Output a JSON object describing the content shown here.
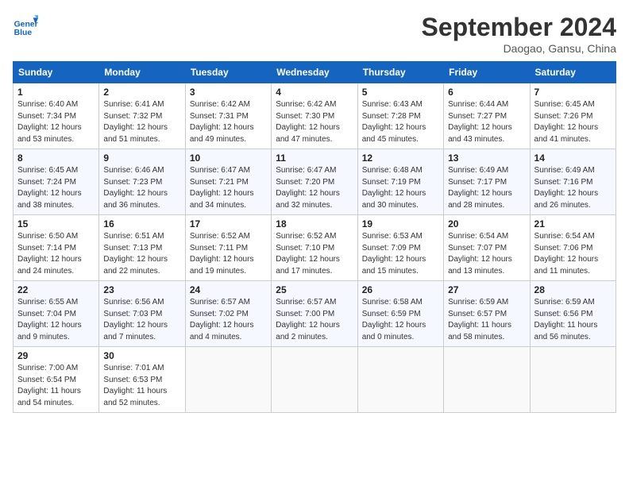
{
  "header": {
    "logo_line1": "General",
    "logo_line2": "Blue",
    "month": "September 2024",
    "location": "Daogao, Gansu, China"
  },
  "weekdays": [
    "Sunday",
    "Monday",
    "Tuesday",
    "Wednesday",
    "Thursday",
    "Friday",
    "Saturday"
  ],
  "weeks": [
    [
      {
        "day": "1",
        "info": "Sunrise: 6:40 AM\nSunset: 7:34 PM\nDaylight: 12 hours\nand 53 minutes."
      },
      {
        "day": "2",
        "info": "Sunrise: 6:41 AM\nSunset: 7:32 PM\nDaylight: 12 hours\nand 51 minutes."
      },
      {
        "day": "3",
        "info": "Sunrise: 6:42 AM\nSunset: 7:31 PM\nDaylight: 12 hours\nand 49 minutes."
      },
      {
        "day": "4",
        "info": "Sunrise: 6:42 AM\nSunset: 7:30 PM\nDaylight: 12 hours\nand 47 minutes."
      },
      {
        "day": "5",
        "info": "Sunrise: 6:43 AM\nSunset: 7:28 PM\nDaylight: 12 hours\nand 45 minutes."
      },
      {
        "day": "6",
        "info": "Sunrise: 6:44 AM\nSunset: 7:27 PM\nDaylight: 12 hours\nand 43 minutes."
      },
      {
        "day": "7",
        "info": "Sunrise: 6:45 AM\nSunset: 7:26 PM\nDaylight: 12 hours\nand 41 minutes."
      }
    ],
    [
      {
        "day": "8",
        "info": "Sunrise: 6:45 AM\nSunset: 7:24 PM\nDaylight: 12 hours\nand 38 minutes."
      },
      {
        "day": "9",
        "info": "Sunrise: 6:46 AM\nSunset: 7:23 PM\nDaylight: 12 hours\nand 36 minutes."
      },
      {
        "day": "10",
        "info": "Sunrise: 6:47 AM\nSunset: 7:21 PM\nDaylight: 12 hours\nand 34 minutes."
      },
      {
        "day": "11",
        "info": "Sunrise: 6:47 AM\nSunset: 7:20 PM\nDaylight: 12 hours\nand 32 minutes."
      },
      {
        "day": "12",
        "info": "Sunrise: 6:48 AM\nSunset: 7:19 PM\nDaylight: 12 hours\nand 30 minutes."
      },
      {
        "day": "13",
        "info": "Sunrise: 6:49 AM\nSunset: 7:17 PM\nDaylight: 12 hours\nand 28 minutes."
      },
      {
        "day": "14",
        "info": "Sunrise: 6:49 AM\nSunset: 7:16 PM\nDaylight: 12 hours\nand 26 minutes."
      }
    ],
    [
      {
        "day": "15",
        "info": "Sunrise: 6:50 AM\nSunset: 7:14 PM\nDaylight: 12 hours\nand 24 minutes."
      },
      {
        "day": "16",
        "info": "Sunrise: 6:51 AM\nSunset: 7:13 PM\nDaylight: 12 hours\nand 22 minutes."
      },
      {
        "day": "17",
        "info": "Sunrise: 6:52 AM\nSunset: 7:11 PM\nDaylight: 12 hours\nand 19 minutes."
      },
      {
        "day": "18",
        "info": "Sunrise: 6:52 AM\nSunset: 7:10 PM\nDaylight: 12 hours\nand 17 minutes."
      },
      {
        "day": "19",
        "info": "Sunrise: 6:53 AM\nSunset: 7:09 PM\nDaylight: 12 hours\nand 15 minutes."
      },
      {
        "day": "20",
        "info": "Sunrise: 6:54 AM\nSunset: 7:07 PM\nDaylight: 12 hours\nand 13 minutes."
      },
      {
        "day": "21",
        "info": "Sunrise: 6:54 AM\nSunset: 7:06 PM\nDaylight: 12 hours\nand 11 minutes."
      }
    ],
    [
      {
        "day": "22",
        "info": "Sunrise: 6:55 AM\nSunset: 7:04 PM\nDaylight: 12 hours\nand 9 minutes."
      },
      {
        "day": "23",
        "info": "Sunrise: 6:56 AM\nSunset: 7:03 PM\nDaylight: 12 hours\nand 7 minutes."
      },
      {
        "day": "24",
        "info": "Sunrise: 6:57 AM\nSunset: 7:02 PM\nDaylight: 12 hours\nand 4 minutes."
      },
      {
        "day": "25",
        "info": "Sunrise: 6:57 AM\nSunset: 7:00 PM\nDaylight: 12 hours\nand 2 minutes."
      },
      {
        "day": "26",
        "info": "Sunrise: 6:58 AM\nSunset: 6:59 PM\nDaylight: 12 hours\nand 0 minutes."
      },
      {
        "day": "27",
        "info": "Sunrise: 6:59 AM\nSunset: 6:57 PM\nDaylight: 11 hours\nand 58 minutes."
      },
      {
        "day": "28",
        "info": "Sunrise: 6:59 AM\nSunset: 6:56 PM\nDaylight: 11 hours\nand 56 minutes."
      }
    ],
    [
      {
        "day": "29",
        "info": "Sunrise: 7:00 AM\nSunset: 6:54 PM\nDaylight: 11 hours\nand 54 minutes."
      },
      {
        "day": "30",
        "info": "Sunrise: 7:01 AM\nSunset: 6:53 PM\nDaylight: 11 hours\nand 52 minutes."
      },
      {
        "day": "",
        "info": ""
      },
      {
        "day": "",
        "info": ""
      },
      {
        "day": "",
        "info": ""
      },
      {
        "day": "",
        "info": ""
      },
      {
        "day": "",
        "info": ""
      }
    ]
  ]
}
